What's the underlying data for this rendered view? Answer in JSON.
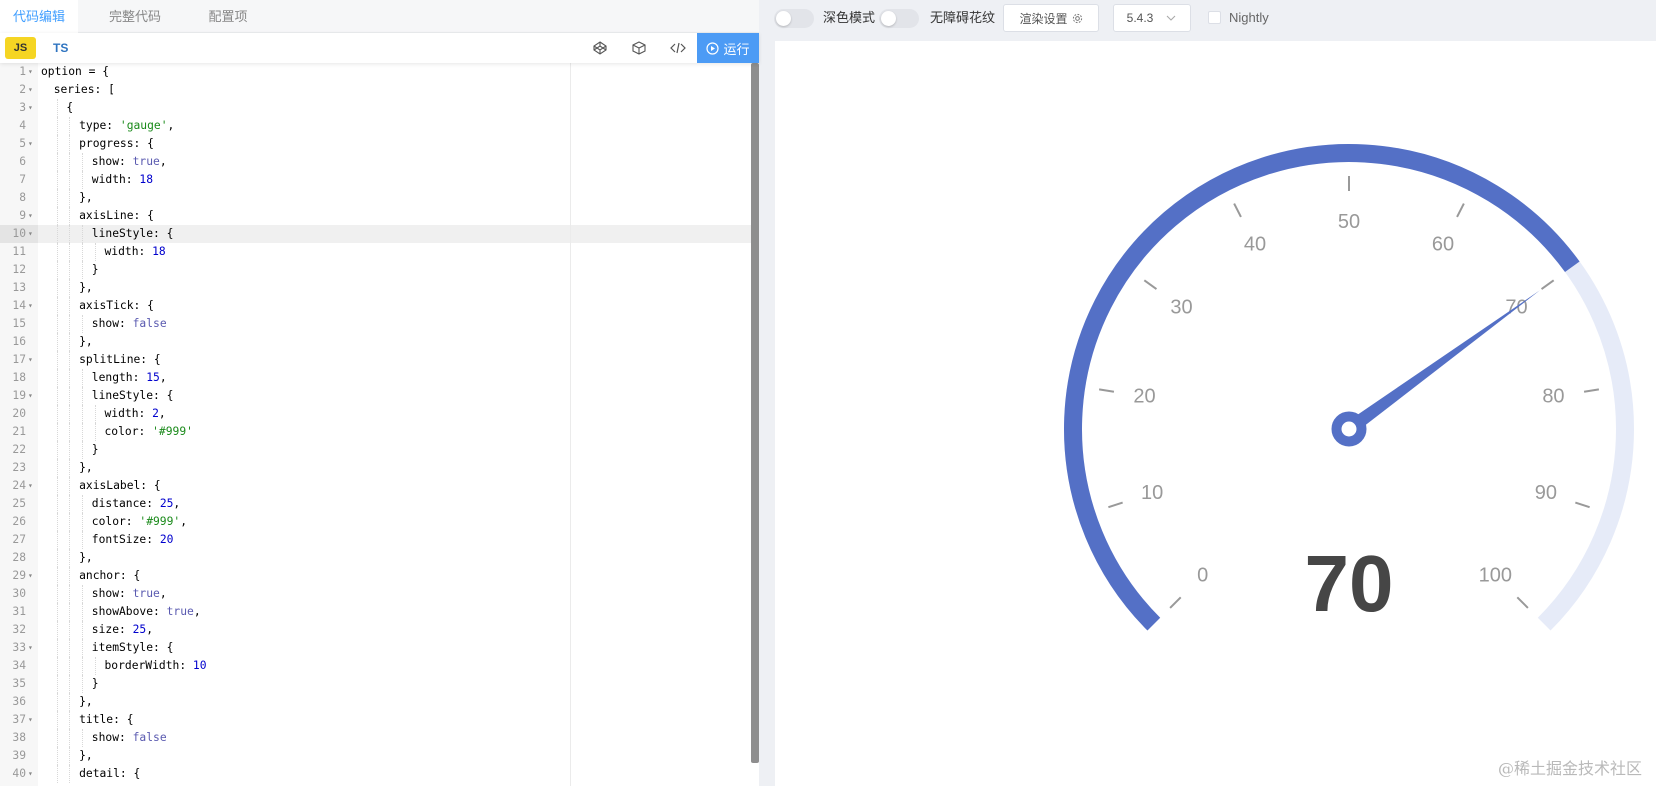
{
  "editor": {
    "tabs": [
      {
        "label": "代码编辑",
        "active": true
      },
      {
        "label": "完整代码",
        "active": false
      },
      {
        "label": "配置项",
        "active": false
      }
    ],
    "lang": {
      "js": "JS",
      "ts": "TS"
    },
    "tools": [
      "codepen-icon",
      "codesandbox-icon",
      "code-format-icon"
    ],
    "run_label": "运行",
    "active_line": 10,
    "lines": [
      {
        "n": "1",
        "fold": true,
        "indent": 0,
        "t": [
          [
            "kw",
            "option = {"
          ]
        ]
      },
      {
        "n": "2",
        "fold": true,
        "indent": 1,
        "t": [
          [
            "kw",
            "series: ["
          ]
        ]
      },
      {
        "n": "3",
        "fold": true,
        "indent": 2,
        "t": [
          [
            "kw",
            "{"
          ]
        ]
      },
      {
        "n": "4",
        "fold": false,
        "indent": 3,
        "t": [
          [
            "kw",
            "type: "
          ],
          [
            "str",
            "'gauge'"
          ],
          [
            "kw",
            ","
          ]
        ]
      },
      {
        "n": "5",
        "fold": true,
        "indent": 3,
        "t": [
          [
            "kw",
            "progress: {"
          ]
        ]
      },
      {
        "n": "6",
        "fold": false,
        "indent": 4,
        "t": [
          [
            "kw",
            "show: "
          ],
          [
            "bool",
            "true"
          ],
          [
            "kw",
            ","
          ]
        ]
      },
      {
        "n": "7",
        "fold": false,
        "indent": 4,
        "t": [
          [
            "kw",
            "width: "
          ],
          [
            "num",
            "18"
          ]
        ]
      },
      {
        "n": "8",
        "fold": false,
        "indent": 3,
        "t": [
          [
            "kw",
            "},"
          ]
        ]
      },
      {
        "n": "9",
        "fold": true,
        "indent": 3,
        "t": [
          [
            "kw",
            "axisLine: {"
          ]
        ]
      },
      {
        "n": "10",
        "fold": true,
        "indent": 4,
        "t": [
          [
            "kw",
            "lineStyle: {"
          ]
        ]
      },
      {
        "n": "11",
        "fold": false,
        "indent": 5,
        "t": [
          [
            "kw",
            "width: "
          ],
          [
            "num",
            "18"
          ]
        ]
      },
      {
        "n": "12",
        "fold": false,
        "indent": 4,
        "t": [
          [
            "kw",
            "}"
          ]
        ]
      },
      {
        "n": "13",
        "fold": false,
        "indent": 3,
        "t": [
          [
            "kw",
            "},"
          ]
        ]
      },
      {
        "n": "14",
        "fold": true,
        "indent": 3,
        "t": [
          [
            "kw",
            "axisTick: {"
          ]
        ]
      },
      {
        "n": "15",
        "fold": false,
        "indent": 4,
        "t": [
          [
            "kw",
            "show: "
          ],
          [
            "bool",
            "false"
          ]
        ]
      },
      {
        "n": "16",
        "fold": false,
        "indent": 3,
        "t": [
          [
            "kw",
            "},"
          ]
        ]
      },
      {
        "n": "17",
        "fold": true,
        "indent": 3,
        "t": [
          [
            "kw",
            "splitLine: {"
          ]
        ]
      },
      {
        "n": "18",
        "fold": false,
        "indent": 4,
        "t": [
          [
            "kw",
            "length: "
          ],
          [
            "num",
            "15"
          ],
          [
            "kw",
            ","
          ]
        ]
      },
      {
        "n": "19",
        "fold": true,
        "indent": 4,
        "t": [
          [
            "kw",
            "lineStyle: {"
          ]
        ]
      },
      {
        "n": "20",
        "fold": false,
        "indent": 5,
        "t": [
          [
            "kw",
            "width: "
          ],
          [
            "num",
            "2"
          ],
          [
            "kw",
            ","
          ]
        ]
      },
      {
        "n": "21",
        "fold": false,
        "indent": 5,
        "t": [
          [
            "kw",
            "color: "
          ],
          [
            "str",
            "'#999'"
          ]
        ]
      },
      {
        "n": "22",
        "fold": false,
        "indent": 4,
        "t": [
          [
            "kw",
            "}"
          ]
        ]
      },
      {
        "n": "23",
        "fold": false,
        "indent": 3,
        "t": [
          [
            "kw",
            "},"
          ]
        ]
      },
      {
        "n": "24",
        "fold": true,
        "indent": 3,
        "t": [
          [
            "kw",
            "axisLabel: {"
          ]
        ]
      },
      {
        "n": "25",
        "fold": false,
        "indent": 4,
        "t": [
          [
            "kw",
            "distance: "
          ],
          [
            "num",
            "25"
          ],
          [
            "kw",
            ","
          ]
        ]
      },
      {
        "n": "26",
        "fold": false,
        "indent": 4,
        "t": [
          [
            "kw",
            "color: "
          ],
          [
            "str",
            "'#999'"
          ],
          [
            "kw",
            ","
          ]
        ]
      },
      {
        "n": "27",
        "fold": false,
        "indent": 4,
        "t": [
          [
            "kw",
            "fontSize: "
          ],
          [
            "num",
            "20"
          ]
        ]
      },
      {
        "n": "28",
        "fold": false,
        "indent": 3,
        "t": [
          [
            "kw",
            "},"
          ]
        ]
      },
      {
        "n": "29",
        "fold": true,
        "indent": 3,
        "t": [
          [
            "kw",
            "anchor: {"
          ]
        ]
      },
      {
        "n": "30",
        "fold": false,
        "indent": 4,
        "t": [
          [
            "kw",
            "show: "
          ],
          [
            "bool",
            "true"
          ],
          [
            "kw",
            ","
          ]
        ]
      },
      {
        "n": "31",
        "fold": false,
        "indent": 4,
        "t": [
          [
            "kw",
            "showAbove: "
          ],
          [
            "bool",
            "true"
          ],
          [
            "kw",
            ","
          ]
        ]
      },
      {
        "n": "32",
        "fold": false,
        "indent": 4,
        "t": [
          [
            "kw",
            "size: "
          ],
          [
            "num",
            "25"
          ],
          [
            "kw",
            ","
          ]
        ]
      },
      {
        "n": "33",
        "fold": true,
        "indent": 4,
        "t": [
          [
            "kw",
            "itemStyle: {"
          ]
        ]
      },
      {
        "n": "34",
        "fold": false,
        "indent": 5,
        "t": [
          [
            "kw",
            "borderWidth: "
          ],
          [
            "num",
            "10"
          ]
        ]
      },
      {
        "n": "35",
        "fold": false,
        "indent": 4,
        "t": [
          [
            "kw",
            "}"
          ]
        ]
      },
      {
        "n": "36",
        "fold": false,
        "indent": 3,
        "t": [
          [
            "kw",
            "},"
          ]
        ]
      },
      {
        "n": "37",
        "fold": true,
        "indent": 3,
        "t": [
          [
            "kw",
            "title: {"
          ]
        ]
      },
      {
        "n": "38",
        "fold": false,
        "indent": 4,
        "t": [
          [
            "kw",
            "show: "
          ],
          [
            "bool",
            "false"
          ]
        ]
      },
      {
        "n": "39",
        "fold": false,
        "indent": 3,
        "t": [
          [
            "kw",
            "},"
          ]
        ]
      },
      {
        "n": "40",
        "fold": true,
        "indent": 3,
        "t": [
          [
            "kw",
            "detail: {"
          ]
        ]
      }
    ]
  },
  "preview": {
    "dark_mode_label": "深色模式",
    "accessible_label": "无障碍花纹",
    "render_settings_label": "渲染设置",
    "version": "5.4.3",
    "nightly_label": "Nightly",
    "watermark": "@稀土掘金技术社区"
  },
  "chart_data": {
    "type": "gauge",
    "min": 0,
    "max": 100,
    "value": 70,
    "detail_text": "70",
    "tick_labels": [
      "0",
      "10",
      "20",
      "30",
      "40",
      "50",
      "60",
      "70",
      "80",
      "90",
      "100"
    ],
    "colors": {
      "progress": "#5470c6",
      "axis": "#e6ebf8",
      "label": "#999999",
      "detail": "#464646"
    }
  }
}
